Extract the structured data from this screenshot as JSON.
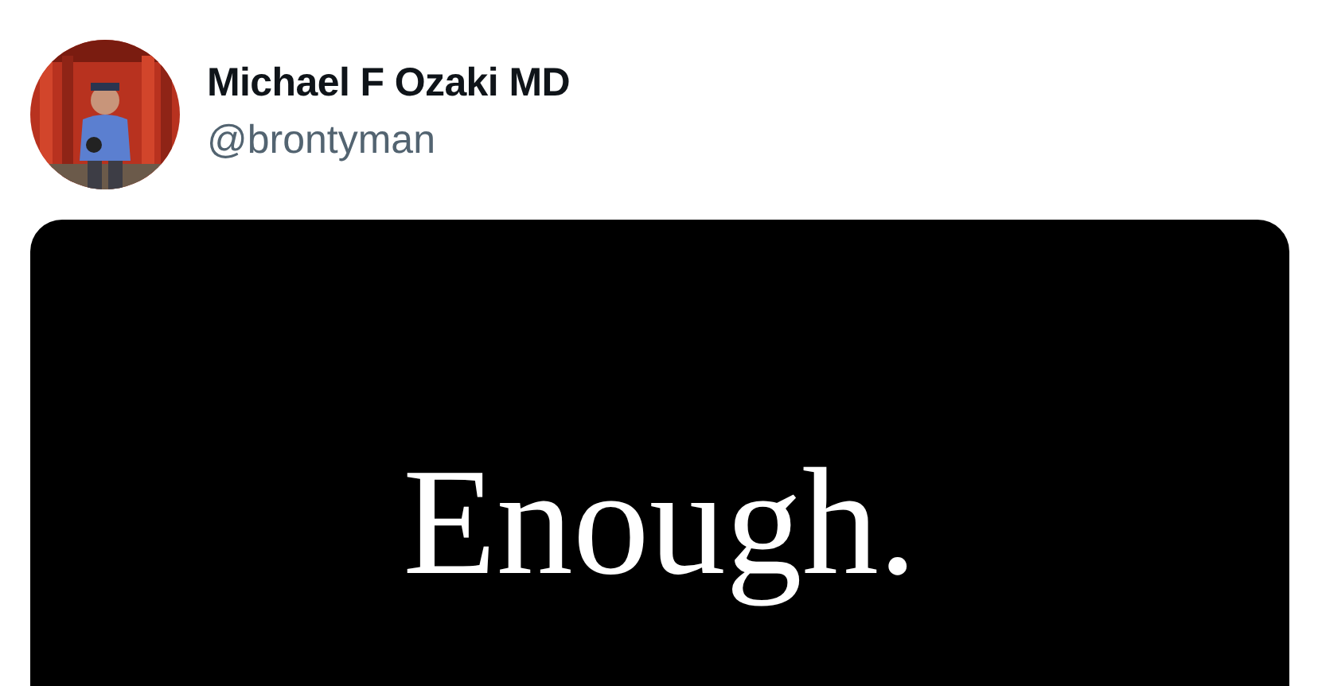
{
  "author": {
    "name": "Michael F Ozaki MD",
    "handle": "@brontyman"
  },
  "media": {
    "text": "Enough."
  }
}
